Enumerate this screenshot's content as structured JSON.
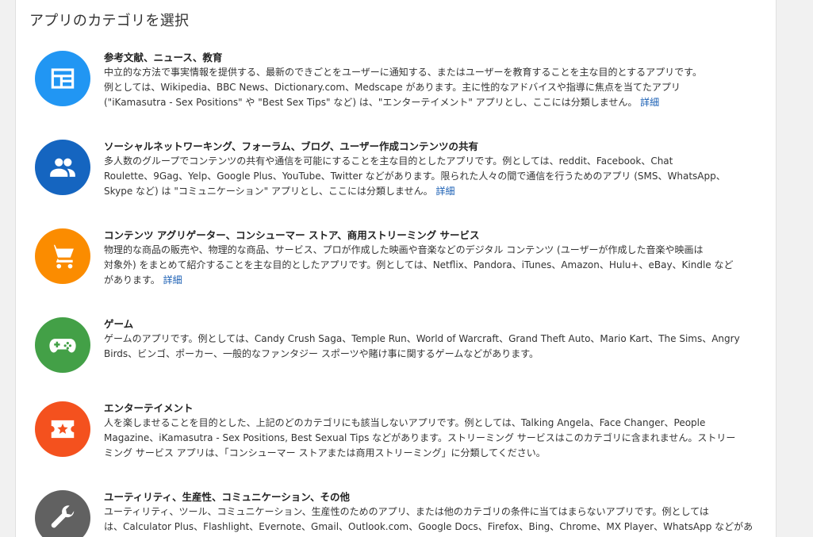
{
  "page_title": "アプリのカテゴリを選択",
  "categories": [
    {
      "name": "参考文献、ニュース、教育",
      "icon": "newspaper-icon",
      "color": "#2196f3",
      "lines": [
        "中立的な方法で事実情報を提供する、最新のできごとをユーザーに通知する、またはユーザーを教育することを主な目的とするアプリです。",
        "例としては、Wikipedia、BBC News、Dictionary.com、Medscape があります。主に性的なアドバイスや指導に焦点を当てたアプリ",
        "(\"iKamasutra - Sex Positions\" や \"Best Sex Tips\" など) は、\"エンターテイメント\" アプリとし、ここには分類しません。"
      ],
      "link": "詳細"
    },
    {
      "name": "ソーシャルネットワーキング、フォーラム、ブログ、ユーザー作成コンテンツの共有",
      "icon": "people-icon",
      "color": "#1565c0",
      "lines": [
        "多人数のグループでコンテンツの共有や通信を可能にすることを主な目的としたアプリです。例としては、reddit、Facebook、Chat",
        "Roulette、9Gag、Yelp、Google Plus、YouTube、Twitter などがあります。限られた人々の間で通信を行うためのアプリ (SMS、WhatsApp、",
        "Skype など) は \"コミュニケーション\" アプリとし、ここには分類しません。"
      ],
      "link": "詳細"
    },
    {
      "name": "コンテンツ アグリゲーター、コンシューマー ストア、商用ストリーミング サービス",
      "icon": "shopping-cart-icon",
      "color": "#fb8c00",
      "lines": [
        "物理的な商品の販売や、物理的な商品、サービス、プロが作成した映画や音楽などのデジタル コンテンツ (ユーザーが作成した音楽や映画は",
        "対象外) をまとめて紹介することを主な目的としたアプリです。例としては、Netflix、Pandora、iTunes、Amazon、Hulu+、eBay、Kindle など",
        "があります。"
      ],
      "link": "詳細"
    },
    {
      "name": "ゲーム",
      "icon": "gamepad-icon",
      "color": "#43a047",
      "lines": [
        "ゲームのアプリです。例としては、Candy Crush Saga、Temple Run、World of Warcraft、Grand Theft Auto、Mario Kart、The Sims、Angry",
        "Birds、ビンゴ、ポーカー、一般的なファンタジー スポーツや賭け事に関するゲームなどがあります。"
      ],
      "link": ""
    },
    {
      "name": "エンターテイメント",
      "icon": "ticket-star-icon",
      "color": "#f4511e",
      "lines": [
        "人を楽しませることを目的とした、上記のどのカテゴリにも該当しないアプリです。例としては、Talking Angela、Face Changer、People",
        "Magazine、iKamasutra - Sex Positions, Best Sexual Tips などがあります。ストリーミング サービスはこのカテゴリに含まれません。ストリー",
        "ミング サービス アプリは、「コンシューマー ストアまたは商用ストリーミング」に分類してください。"
      ],
      "link": ""
    },
    {
      "name": "ユーティリティ、生産性、コミュニケーション、その他",
      "icon": "wrench-icon",
      "color": "#616161",
      "lines": [
        "ユーティリティ、ツール、コミュニケーション、生産性のためのアプリ、または他のカテゴリの条件に当てはまらないアプリです。例としては",
        "は、Calculator Plus、Flashlight、Evernote、Gmail、Outlook.com、Google Docs、Firefox、Bing、Chrome、MX Player、WhatsApp などがあ"
      ],
      "link": ""
    }
  ]
}
